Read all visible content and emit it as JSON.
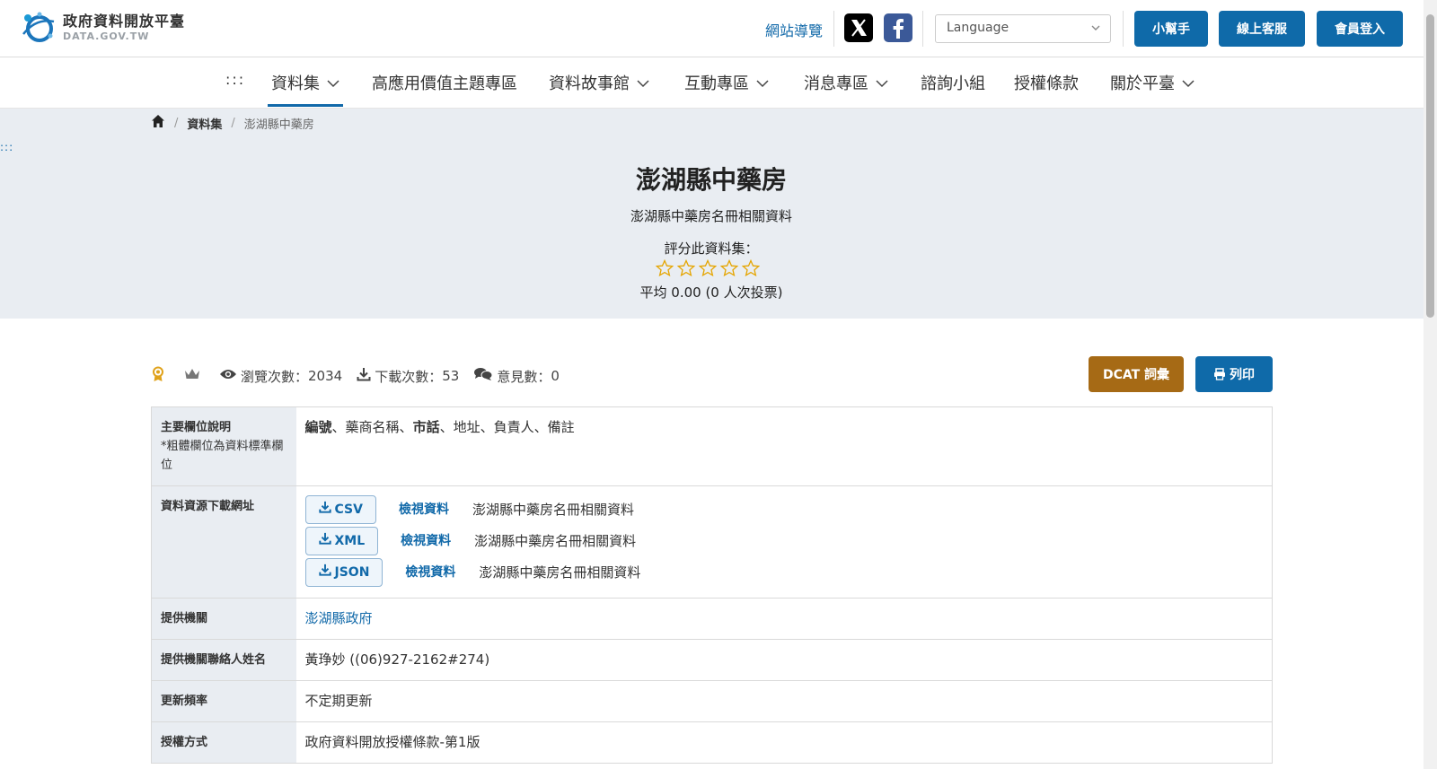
{
  "header": {
    "logo_title": "政府資料開放平臺",
    "logo_sub": "DATA.GOV.TW",
    "site_nav": "網站導覽",
    "language_placeholder": "Language",
    "buttons": {
      "helper": "小幫手",
      "support": "線上客服",
      "login": "會員登入"
    }
  },
  "nav": {
    "access_key": ":::",
    "items": [
      "資料集",
      "高應用價值主題專區",
      "資料故事館",
      "互動專區",
      "消息專區",
      "諮詢小組",
      "授權條款",
      "關於平臺"
    ]
  },
  "breadcrumb": {
    "datasets": "資料集",
    "current": "澎湖縣中藥房"
  },
  "hero": {
    "access_key": ":::",
    "title": "澎湖縣中藥房",
    "description": "澎湖縣中藥房名冊相關資料",
    "rate_label": "評分此資料集：",
    "rating_stars": 0,
    "average": "平均 0.00 (0 人次投票)"
  },
  "stats": {
    "views_label": "瀏覽次數：",
    "views": "2034",
    "downloads_label": "下載次數：",
    "downloads": "53",
    "comments_label": "意見數：",
    "comments": "0"
  },
  "actions": {
    "dcat": "DCAT 詞彙",
    "print": "列印"
  },
  "table": {
    "fields_label": "主要欄位說明",
    "fields_note": "*粗體欄位為資料標準欄位",
    "fields": [
      {
        "name": "編號",
        "bold": true
      },
      {
        "name": "藥商名稱",
        "bold": false
      },
      {
        "name": "市話",
        "bold": true
      },
      {
        "name": "地址",
        "bold": false
      },
      {
        "name": "負責人",
        "bold": false
      },
      {
        "name": "備註",
        "bold": false
      }
    ],
    "field_sep": "、",
    "resources_label": "資料資源下載網址",
    "resources": [
      {
        "format": "CSV",
        "view": "檢視資料",
        "desc": "澎湖縣中藥房名冊相關資料"
      },
      {
        "format": "XML",
        "view": "檢視資料",
        "desc": "澎湖縣中藥房名冊相關資料"
      },
      {
        "format": "JSON",
        "view": "檢視資料",
        "desc": "澎湖縣中藥房名冊相關資料"
      }
    ],
    "agency_label": "提供機關",
    "agency": "澎湖縣政府",
    "contact_label": "提供機關聯絡人姓名",
    "contact": "黃琤妙 ((06)927-2162#274)",
    "frequency_label": "更新頻率",
    "frequency": "不定期更新",
    "license_label": "授權方式",
    "license": "政府資料開放授權條款-第1版"
  },
  "colors": {
    "primary": "#0f6aa9",
    "dcat": "#a66a15",
    "hero_bg": "#e9edf2",
    "star": "#e5a500"
  }
}
